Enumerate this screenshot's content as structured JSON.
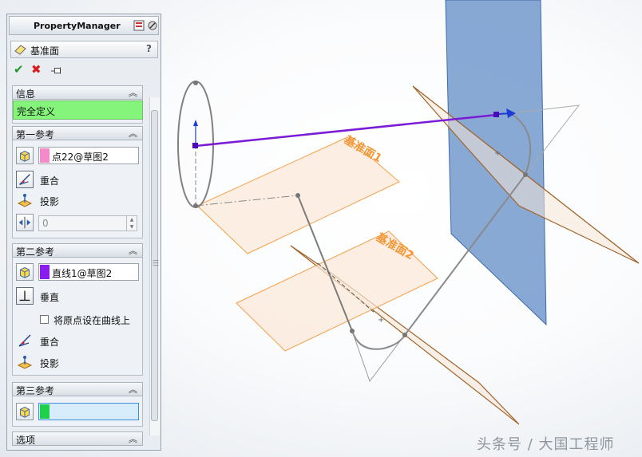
{
  "panel": {
    "title": "PropertyManager",
    "feature": {
      "name": "基准面",
      "help": "?"
    },
    "actions": {
      "ok": "✔",
      "cancel": "✖",
      "pin": "pin-icon"
    }
  },
  "sections": {
    "info": {
      "label": "信息",
      "message": "完全定义"
    },
    "ref1": {
      "label": "第一参考",
      "selection": "点22@草图2",
      "swatch_color": "#f58ac8",
      "coincident": "重合",
      "project": "投影",
      "distance": "0"
    },
    "ref2": {
      "label": "第二参考",
      "selection": "直线1@草图2",
      "swatch_color": "#8a1cf0",
      "perpendicular": "垂直",
      "origin_on_curve": "将原点设在曲线上",
      "coincident": "重合",
      "project": "投影"
    },
    "ref3": {
      "label": "第三参考",
      "selection": "",
      "swatch_color": "#1fd04a"
    },
    "options": {
      "label": "选项"
    }
  },
  "viewport": {
    "plane1_label": "基准面1",
    "plane2_label": "基准面2",
    "colors": {
      "plane_orange": "#f5a04a",
      "plane_blue": "#5a88c4",
      "vector_purple": "#7a1cd6",
      "plane_brown": "#a0642a"
    }
  },
  "watermark": "头条号 / 大国工程师"
}
